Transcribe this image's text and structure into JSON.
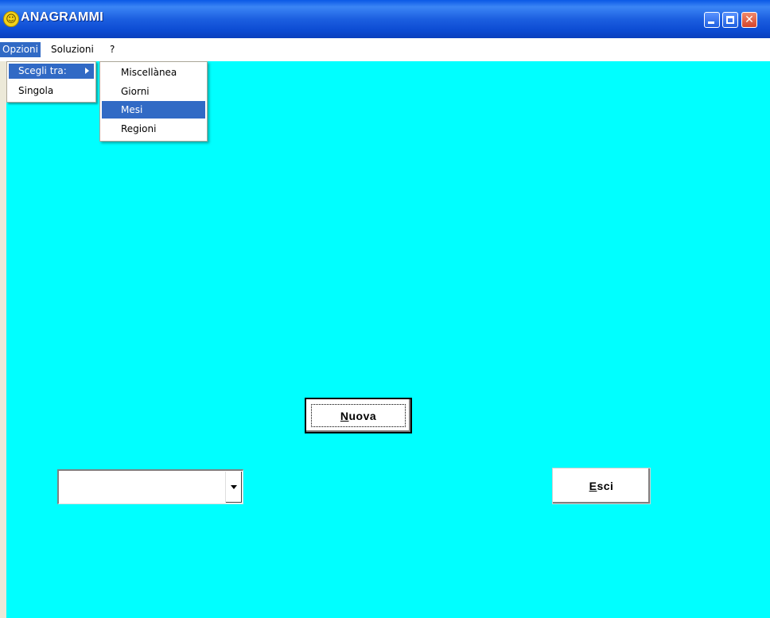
{
  "window": {
    "title": "ANAGRAMMI",
    "icon": "smiley-icon"
  },
  "menubar": {
    "items": [
      "Opzioni",
      "Soluzioni",
      "?"
    ]
  },
  "opzioni_menu": {
    "items": [
      "Scegli tra:",
      "Singola"
    ]
  },
  "scegli_submenu": {
    "items": [
      "Miscellànea",
      "Giorni",
      "Mesi",
      "Regioni"
    ],
    "highlighted": "Mesi"
  },
  "buttons": {
    "nuova_mnemonic": "N",
    "nuova_rest": "uova",
    "esci_mnemonic": "E",
    "esci_rest": "sci"
  },
  "combo": {
    "value": ""
  },
  "colors": {
    "client_bg": "#00ffff",
    "highlight": "#316ac5"
  }
}
